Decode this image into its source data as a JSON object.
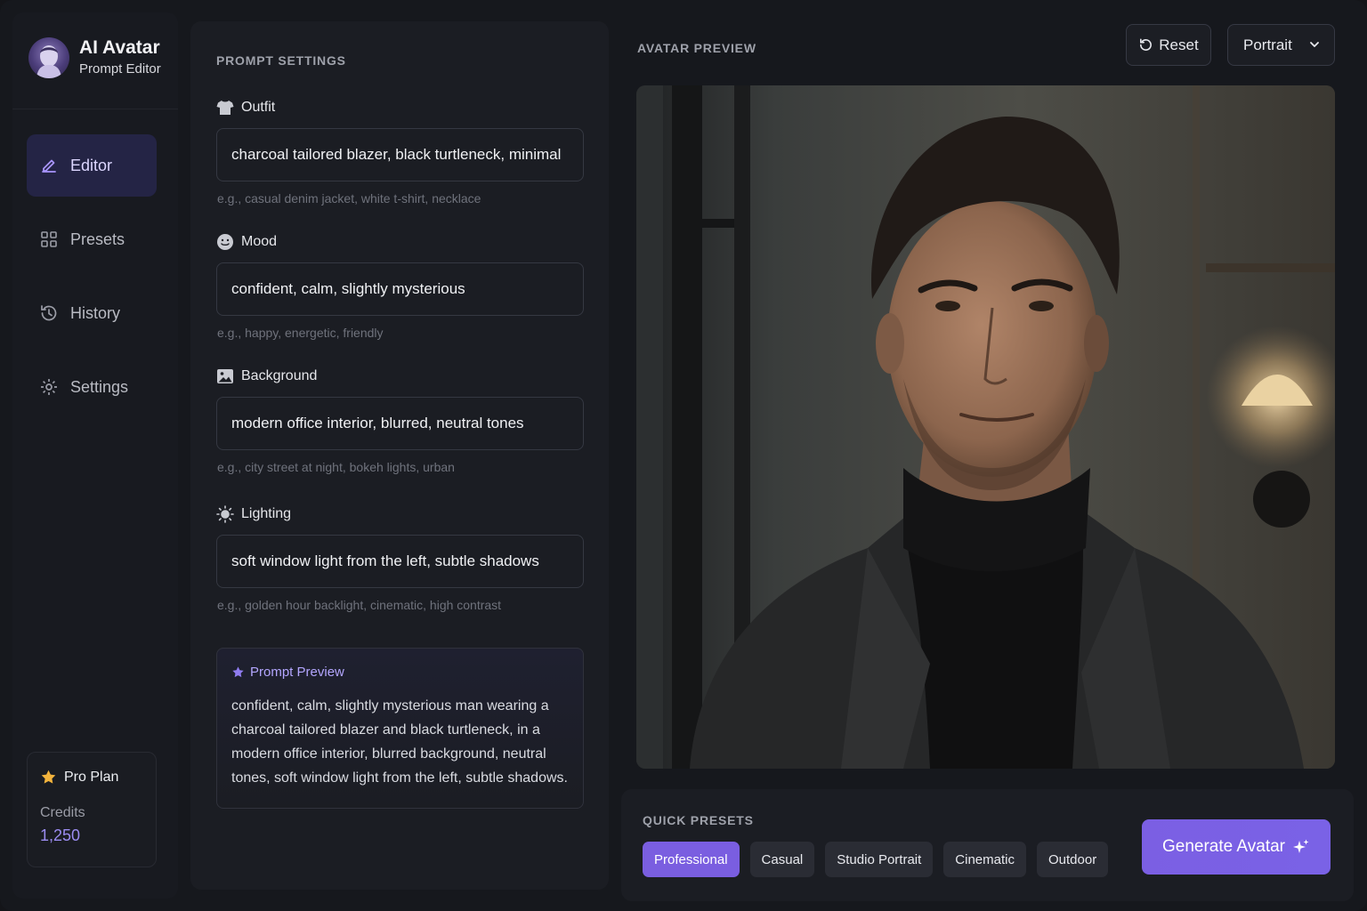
{
  "brand": {
    "title": "AI Avatar",
    "subtitle": "Prompt Editor",
    "accent": "#7a5ee0"
  },
  "sidebar": {
    "items": [
      {
        "label": "Editor",
        "icon": "pencil-icon",
        "active": true
      },
      {
        "label": "Presets",
        "icon": "grid-icon",
        "active": false
      },
      {
        "label": "History",
        "icon": "history-icon",
        "active": false
      },
      {
        "label": "Settings",
        "icon": "gear-icon",
        "active": false
      }
    ],
    "plan": {
      "name": "Pro Plan",
      "credits_label": "Credits",
      "credits_value": "1,250"
    }
  },
  "prompt_settings": {
    "section_label": "PROMPT SETTINGS",
    "fields": [
      {
        "label": "Outfit",
        "icon": "shirt-icon",
        "value": "charcoal tailored blazer, black turtleneck, minimal",
        "hint": "e.g., casual denim jacket, white t-shirt, necklace"
      },
      {
        "label": "Mood",
        "icon": "smiley-icon",
        "value": "confident, calm, slightly mysterious",
        "hint": "e.g., happy, energetic, friendly"
      },
      {
        "label": "Background",
        "icon": "image-icon",
        "value": "modern office interior, blurred, neutral tones",
        "hint": "e.g., city street at night, bokeh lights, urban"
      },
      {
        "label": "Lighting",
        "icon": "sun-icon",
        "value": "soft window light from the left, subtle shadows",
        "hint": "e.g., golden hour backlight, cinematic, high contrast"
      }
    ],
    "preview": {
      "title": "Prompt Preview",
      "text": "confident, calm, slightly mysterious man wearing a charcoal tailored blazer and black turtleneck, in a modern office interior, blurred background, neutral tones, soft window light from the left, subtle shadows."
    }
  },
  "avatar_preview": {
    "section_label": "AVATAR PREVIEW",
    "reset_label": "Reset",
    "aspect_selected": "Portrait"
  },
  "quick_presets": {
    "section_label": "QUICK PRESETS",
    "chips": [
      "Professional",
      "Casual",
      "Studio Portrait",
      "Cinematic",
      "Outdoor"
    ],
    "active_index": 0,
    "generate_label": "Generate Avatar"
  }
}
